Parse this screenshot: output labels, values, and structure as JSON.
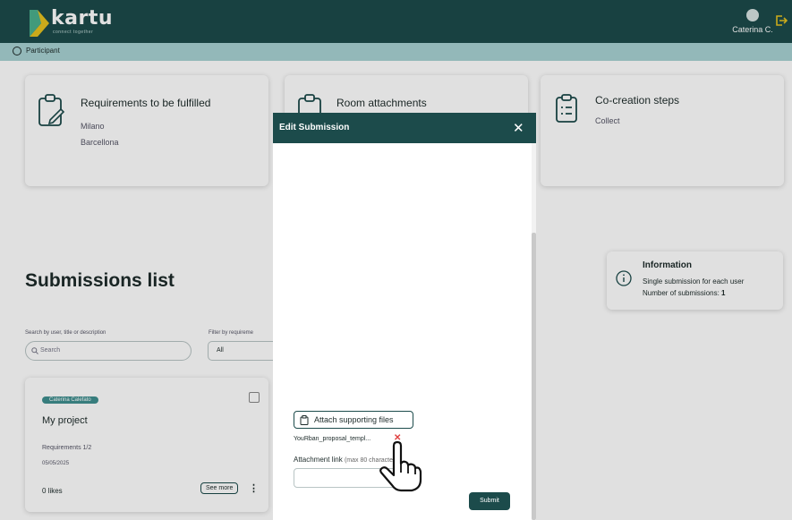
{
  "header": {
    "logo_text": "kartu",
    "logo_subtitle": "connect together",
    "user_name": "Caterina C."
  },
  "role": {
    "label": "Participant"
  },
  "cards": {
    "requirements": {
      "title": "Requirements to be fulfilled",
      "items": [
        "Milano",
        "Barcellona"
      ]
    },
    "attachments": {
      "title": "Room attachments"
    },
    "cocreation": {
      "title": "Co-creation steps",
      "items": [
        "Collect"
      ]
    }
  },
  "submissions": {
    "title": "Submissions list",
    "search_label": "Search by user, title or description",
    "search_placeholder": "Search",
    "filter_label": "Filter by requireme",
    "filter_value": "All"
  },
  "info": {
    "title": "Information",
    "line1": "Single submission for each user",
    "line2_prefix": "Number of submissions: ",
    "count": "1"
  },
  "submission_card": {
    "author_badge": "Caterina Calefato",
    "title": "My project",
    "requirements": "Requirements 1/2",
    "date": "05/05/2025",
    "likes": "0 likes",
    "see_more": "See more"
  },
  "modal": {
    "title": "Edit Submission",
    "attach_label": "Attach supporting files",
    "filename": "YouRban_proposal_templ...",
    "link_label": "Attachment link",
    "link_hint": "(max 80 characters)",
    "submit": "Submit"
  },
  "colors": {
    "primary": "#1c4b4b",
    "role_bar": "#a8d2d3",
    "badge": "#3f8f8f",
    "remove": "#e04040"
  }
}
